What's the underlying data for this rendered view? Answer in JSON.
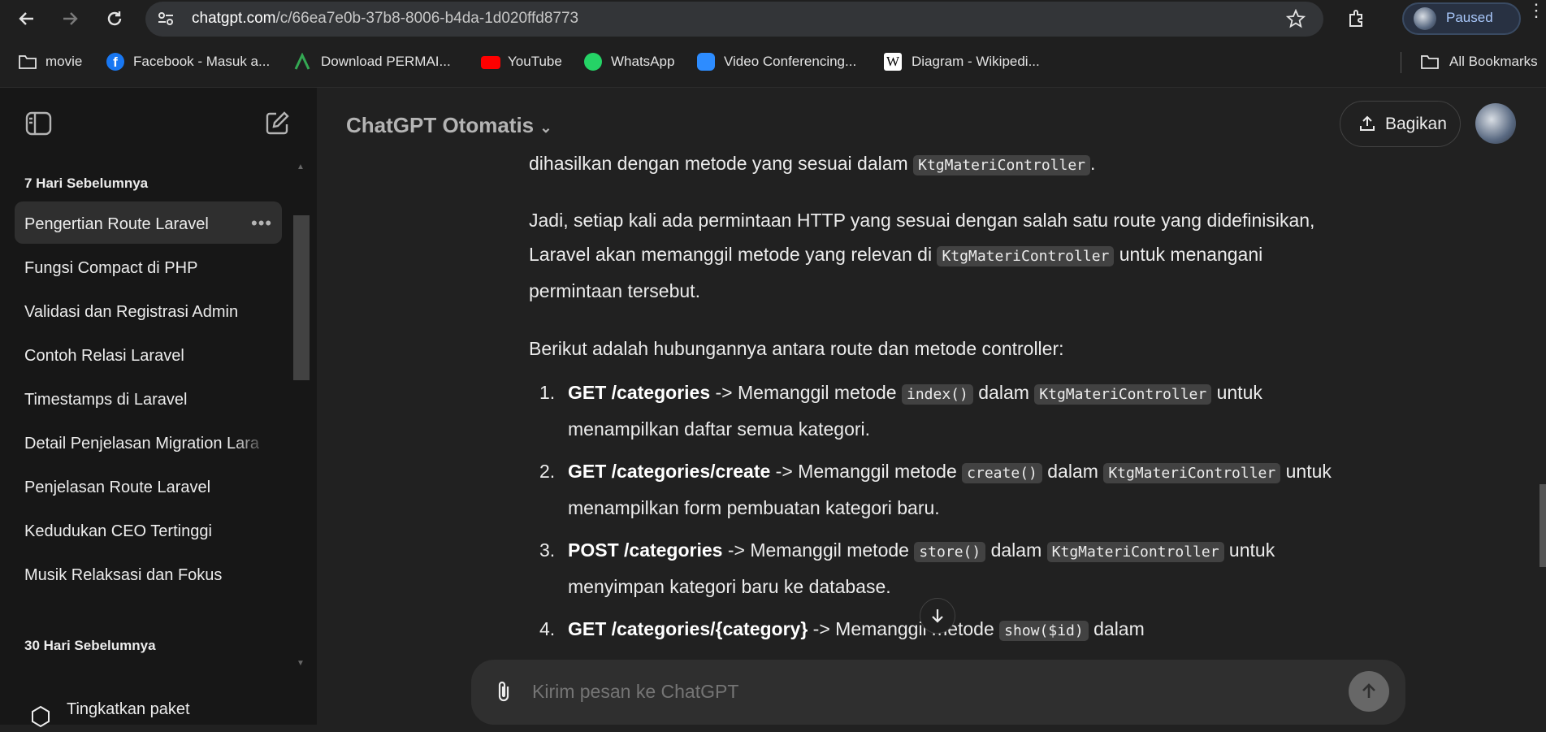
{
  "browser": {
    "url_host": "chatgpt.com",
    "url_path": "/c/66ea7e0b-37b8-8006-b4da-1d020ffd8773",
    "profile_status": "Paused",
    "bookmarks": [
      {
        "label": "movie",
        "icon": "folder-icon"
      },
      {
        "label": "Facebook - Masuk a...",
        "icon": "facebook-icon",
        "color": "#1877f2"
      },
      {
        "label": "Download PERMAI...",
        "icon": "permai-icon",
        "color": "#34a853"
      },
      {
        "label": "YouTube",
        "icon": "youtube-icon",
        "color": "#ff0000"
      },
      {
        "label": "WhatsApp",
        "icon": "whatsapp-icon",
        "color": "#25d366"
      },
      {
        "label": "Video Conferencing...",
        "icon": "zoom-icon",
        "color": "#2d8cff"
      },
      {
        "label": "Diagram - Wikipedi...",
        "icon": "wikipedia-icon"
      }
    ],
    "all_bookmarks": "All Bookmarks"
  },
  "sidebar": {
    "section1": "7 Hari Sebelumnya",
    "items": [
      "Pengertian Route Laravel",
      "Fungsi Compact di PHP",
      "Validasi dan Registrasi Admin",
      "Contoh Relasi Laravel",
      "Timestamps di Laravel",
      "Detail Penjelasan Migration Lara",
      "Penjelasan Route Laravel",
      "Kedudukan CEO Tertinggi",
      "Musik Relaksasi dan Fokus"
    ],
    "section2": "30 Hari Sebelumnya",
    "upgrade": "Tingkatkan paket"
  },
  "header": {
    "title": "ChatGPT Otomatis",
    "share": "Bagikan"
  },
  "message": {
    "p0_pre": "dihasilkan dengan metode yang sesuai dalam ",
    "p0_code": "KtgMateriController",
    "p0_post": ".",
    "p1_a": "Jadi, setiap kali ada permintaan HTTP yang sesuai dengan salah satu route yang didefinisikan, Laravel akan memanggil metode yang relevan di ",
    "p1_code": "KtgMateriController",
    "p1_b": " untuk menangani permintaan tersebut.",
    "p2": "Berikut adalah hubungannya antara route dan metode controller:",
    "list": [
      {
        "num": "1.",
        "route": "GET /categories",
        "mid": " -> Memanggil metode ",
        "method": "index()",
        "in": " dalam ",
        "ctrl": "KtgMateriController",
        "rest": " untuk menampilkan daftar semua kategori."
      },
      {
        "num": "2.",
        "route": "GET /categories/create",
        "mid": " -> Memanggil metode ",
        "method": "create()",
        "in": " dalam ",
        "ctrl": "KtgMateriController",
        "rest": " untuk menampilkan form pembuatan kategori baru."
      },
      {
        "num": "3.",
        "route": "POST /categories",
        "mid": " -> Memanggil metode ",
        "method": "store()",
        "in": " dalam ",
        "ctrl": "KtgMateriController",
        "rest": " untuk menyimpan kategori baru ke database."
      },
      {
        "num": "4.",
        "route": "GET /categories/{category}",
        "mid": " -> Memanggil metode ",
        "method": "show($id)",
        "in": " dalam",
        "ctrl": "",
        "rest": ""
      }
    ]
  },
  "composer": {
    "placeholder": "Kirim pesan ke ChatGPT"
  }
}
